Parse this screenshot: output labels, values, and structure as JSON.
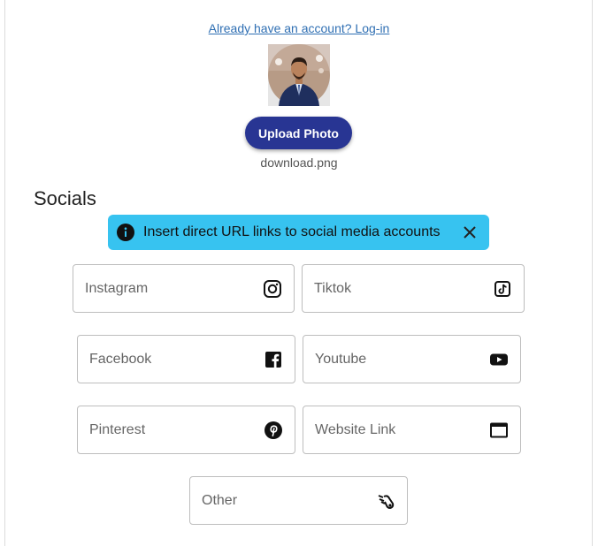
{
  "header": {
    "login_link": "Already have an account? Log-in"
  },
  "profile": {
    "avatar_alt": "profile photo",
    "upload_button": "Upload Photo",
    "file_name": "download.png"
  },
  "socials": {
    "heading": "Socials",
    "alert_message": "Insert direct URL links to social media accounts",
    "fields": {
      "instagram": {
        "placeholder": "Instagram",
        "icon": "instagram-icon"
      },
      "tiktok": {
        "placeholder": "Tiktok",
        "icon": "tiktok-icon"
      },
      "facebook": {
        "placeholder": "Facebook",
        "icon": "facebook-icon"
      },
      "youtube": {
        "placeholder": "Youtube",
        "icon": "youtube-icon"
      },
      "pinterest": {
        "placeholder": "Pinterest",
        "icon": "pinterest-icon"
      },
      "website": {
        "placeholder": "Website Link",
        "icon": "browser-window-icon"
      },
      "other": {
        "placeholder": "Other",
        "icon": "link-icon"
      }
    }
  },
  "colors": {
    "primary_button": "#283593",
    "alert_background": "#37c3f0",
    "link": "#2f6fb3"
  }
}
